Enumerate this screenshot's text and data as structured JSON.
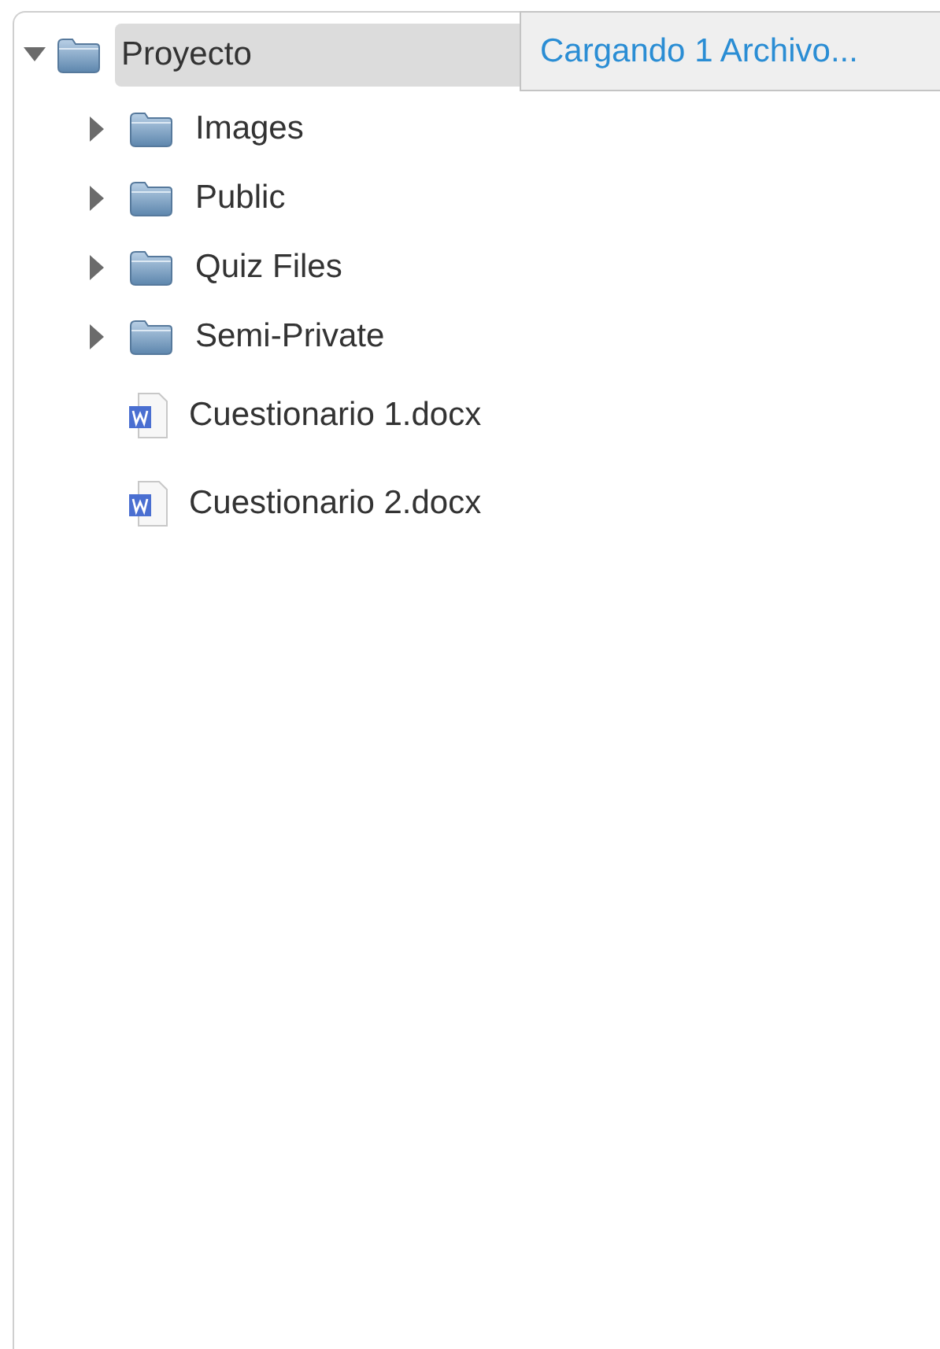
{
  "tree": {
    "label": "Proyecto",
    "kind": "folder",
    "expanded": true,
    "selected": true,
    "children": [
      {
        "label": "Images",
        "kind": "folder",
        "expanded": false,
        "selected": false
      },
      {
        "label": "Public",
        "kind": "folder",
        "expanded": false,
        "selected": false
      },
      {
        "label": "Quiz Files",
        "kind": "folder",
        "expanded": false,
        "selected": false
      },
      {
        "label": "Semi-Private",
        "kind": "folder",
        "expanded": false,
        "selected": false
      },
      {
        "label": "Cuestionario 1.docx",
        "kind": "file",
        "selected": false
      },
      {
        "label": "Cuestionario 2.docx",
        "kind": "file",
        "selected": false
      }
    ]
  },
  "tooltip": {
    "text": "Cargando 1 Archivo..."
  }
}
